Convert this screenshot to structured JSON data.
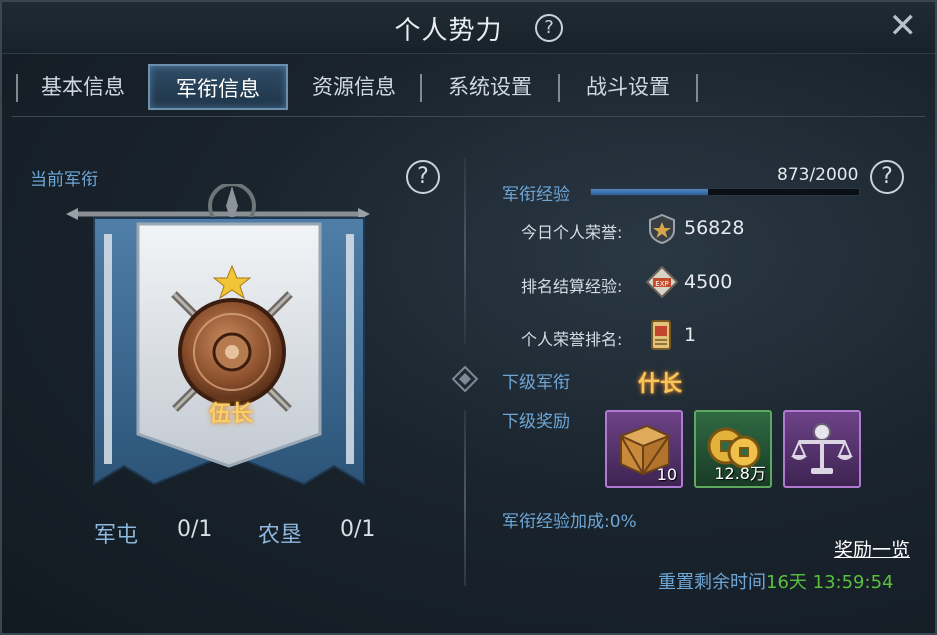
{
  "window": {
    "title": "个人势力",
    "help_icon": "question-icon",
    "close_icon": "close-icon"
  },
  "tabs": [
    {
      "label": "基本信息",
      "active": false
    },
    {
      "label": "军衔信息",
      "active": true
    },
    {
      "label": "资源信息",
      "active": false
    },
    {
      "label": "系统设置",
      "active": false
    },
    {
      "label": "战斗设置",
      "active": false
    }
  ],
  "current_rank": {
    "label": "当前军衔",
    "rank_name": "伍长",
    "sub_ranks": [
      {
        "name": "军屯",
        "value": "0/1"
      },
      {
        "name": "农垦",
        "value": "0/1"
      }
    ]
  },
  "rank_exp": {
    "label": "军衔经验",
    "current": 873,
    "max": 2000,
    "text": "873/2000",
    "fill_fraction": 0.4365
  },
  "stats": [
    {
      "label": "今日个人荣誉:",
      "icon": "honor-medal-icon",
      "value": "56828"
    },
    {
      "label": "排名结算经验:",
      "icon": "exp-badge-icon",
      "value": "4500"
    },
    {
      "label": "个人荣誉排名:",
      "icon": "rank-scroll-icon",
      "value": "1"
    }
  ],
  "next_rank": {
    "label": "下级军衔",
    "value": "什长"
  },
  "next_reward": {
    "label": "下级奖励",
    "items": [
      {
        "icon": "wooden-crate-icon",
        "qty": "10",
        "border": "#b07ad0"
      },
      {
        "icon": "copper-coins-icon",
        "qty": "12.8万",
        "border": "#5fa860"
      },
      {
        "icon": "balance-scale-icon",
        "qty": "",
        "border": "#b07ad0"
      }
    ]
  },
  "exp_bonus": "军衔经验加成:0%",
  "reward_list_link": "奖励一览",
  "reset": {
    "label": "重置剩余时间",
    "time": "16天 13:59:54"
  },
  "colors": {
    "accent_blue": "#6ea6d6",
    "gold": "#f4c85a",
    "timer_green": "#58c03e"
  }
}
